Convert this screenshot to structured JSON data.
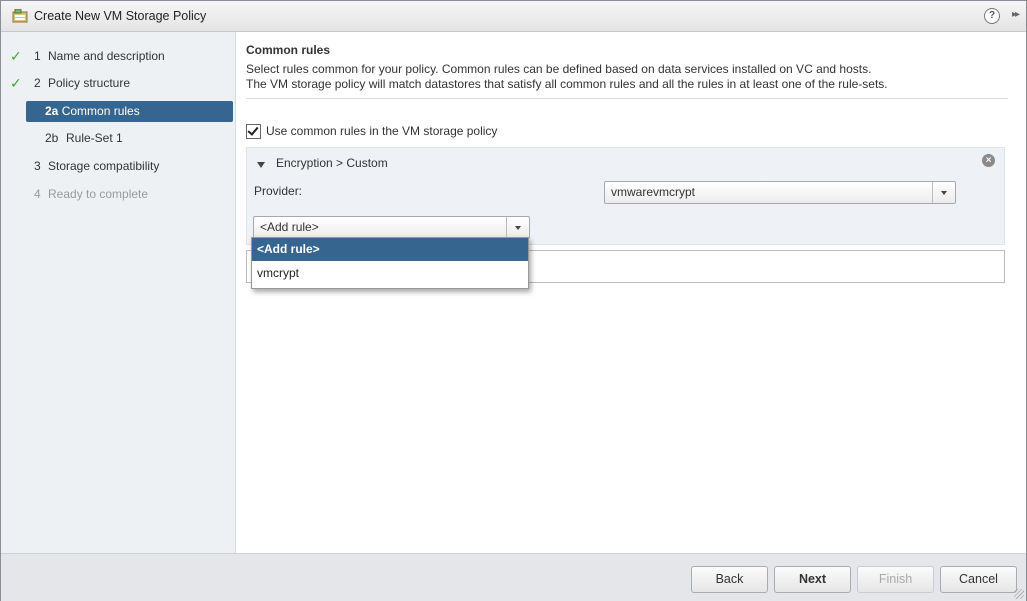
{
  "window": {
    "title": "Create New VM Storage Policy",
    "help_icon": "?",
    "expand_icon": "▸▸"
  },
  "steps": [
    {
      "number": "1",
      "label": "Name and description",
      "done": true
    },
    {
      "number": "2",
      "label": "Policy structure",
      "done": true
    },
    {
      "number": "2a",
      "label": "Common rules",
      "active": true
    },
    {
      "number": "2b",
      "label": "Rule-Set 1"
    },
    {
      "number": "3",
      "label": "Storage compatibility"
    },
    {
      "number": "4",
      "label": "Ready to complete",
      "disabled": true
    }
  ],
  "main": {
    "heading": "Common rules",
    "description_line1": "Select rules common for your policy. Common rules can be defined based on data services installed on VC and hosts.",
    "description_line2": "The VM storage policy will match datastores that satisfy all common rules and all the rules in at least one of the rule-sets.",
    "use_common_rules_label": "Use common rules in the VM storage policy",
    "use_common_rules_checked": true,
    "rule_group": {
      "title": "Encryption > Custom",
      "provider_label": "Provider:",
      "provider_value": "vmwarevmcrypt",
      "add_rule_value": "<Add rule>"
    },
    "add_rule_dropdown": {
      "options": [
        "<Add rule>",
        "vmcrypt"
      ],
      "selected": "<Add rule>"
    }
  },
  "footer": {
    "back": "Back",
    "next": "Next",
    "finish": "Finish",
    "cancel": "Cancel"
  },
  "colors": {
    "accent": "#36658f",
    "check": "#3aa63a"
  }
}
